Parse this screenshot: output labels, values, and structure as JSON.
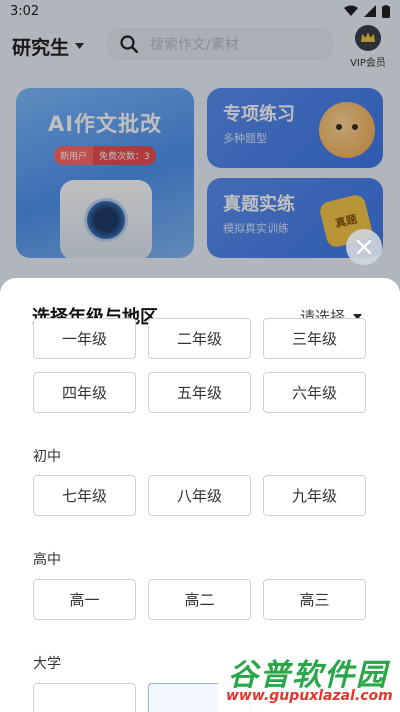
{
  "status_bar": {
    "time": "3:02"
  },
  "header": {
    "grade_label": "研究生",
    "search_placeholder": "搜索作文/素材",
    "vip_label": "VIP会员"
  },
  "cards": {
    "ai": {
      "title": "AI作文批改",
      "badge_new": "新用户",
      "badge_free": "免费次数：3"
    },
    "special": {
      "title": "专项练习",
      "subtitle": "多种题型"
    },
    "real": {
      "title": "真题实练",
      "subtitle": "模拟真实训练",
      "book_label": "真题"
    }
  },
  "sheet": {
    "title": "选择年级与地区",
    "region_placeholder": "请选择",
    "row_primary_1": [
      "一年级",
      "二年级",
      "三年级"
    ],
    "row_primary_2": [
      "四年级",
      "五年级",
      "六年级"
    ],
    "junior_label": "初中",
    "junior": [
      "七年级",
      "八年级",
      "九年级"
    ],
    "senior_label": "高中",
    "senior": [
      "高一",
      "高二",
      "高三"
    ],
    "university_label": "大学"
  },
  "watermark": {
    "cn": "谷普软件园",
    "en": "www.gupuxlazal.com"
  },
  "colors": {
    "accent": "#4a86ee",
    "badge": "#ff6a6a",
    "watermark_green": "#29a648",
    "watermark_red": "#e2352b"
  }
}
